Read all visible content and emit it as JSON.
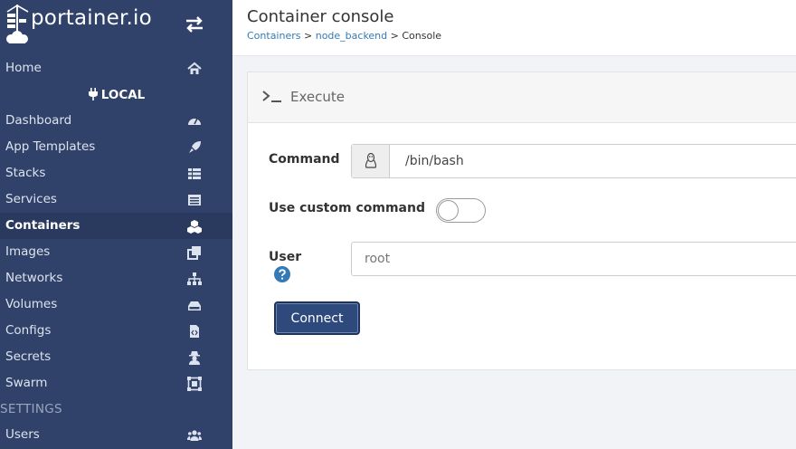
{
  "brand": {
    "name": "portainer.io"
  },
  "nav": {
    "home": "Home",
    "endpoint": "LOCAL",
    "items": [
      {
        "label": "Dashboard",
        "icon": "tachometer-icon"
      },
      {
        "label": "App Templates",
        "icon": "rocket-icon"
      },
      {
        "label": "Stacks",
        "icon": "list-icon"
      },
      {
        "label": "Services",
        "icon": "services-icon"
      },
      {
        "label": "Containers",
        "icon": "cubes-icon",
        "active": true
      },
      {
        "label": "Images",
        "icon": "clone-icon"
      },
      {
        "label": "Networks",
        "icon": "sitemap-icon"
      },
      {
        "label": "Volumes",
        "icon": "hdd-icon"
      },
      {
        "label": "Configs",
        "icon": "file-code-icon"
      },
      {
        "label": "Secrets",
        "icon": "user-secret-icon"
      },
      {
        "label": "Swarm",
        "icon": "object-group-icon"
      }
    ],
    "settings_section": "SETTINGS",
    "users": "Users"
  },
  "header": {
    "title": "Container console",
    "breadcrumb": {
      "containers": "Containers",
      "container": "node_backend",
      "current": "Console",
      "sep": ">"
    }
  },
  "panel": {
    "title": "Execute",
    "command_label": "Command",
    "command_value": "/bin/bash",
    "custom_command_label": "Use custom command",
    "custom_command_enabled": false,
    "user_label": "User",
    "user_placeholder": "root",
    "connect_label": "Connect"
  },
  "colors": {
    "sidebar": "#30426a",
    "accent": "#337ab7",
    "button": "#2e4a7d"
  }
}
